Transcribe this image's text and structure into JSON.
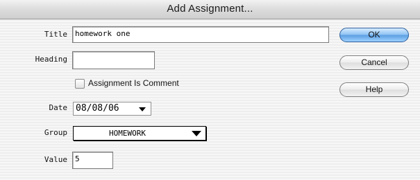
{
  "dialog": {
    "title": "Add Assignment..."
  },
  "fields": {
    "title": {
      "label": "Title",
      "value": "homework one"
    },
    "heading": {
      "label": "Heading",
      "value": ""
    },
    "comment_checkbox": {
      "label": "Assignment Is Comment",
      "checked": false
    },
    "date": {
      "label": "Date",
      "value": "08/08/06"
    },
    "group": {
      "label": "Group",
      "value": "HOMEWORK"
    },
    "value": {
      "label": "Value",
      "value": "5"
    }
  },
  "buttons": {
    "ok": "OK",
    "cancel": "Cancel",
    "help": "Help"
  },
  "icons": {
    "dropdown": "chevron-down-icon"
  }
}
